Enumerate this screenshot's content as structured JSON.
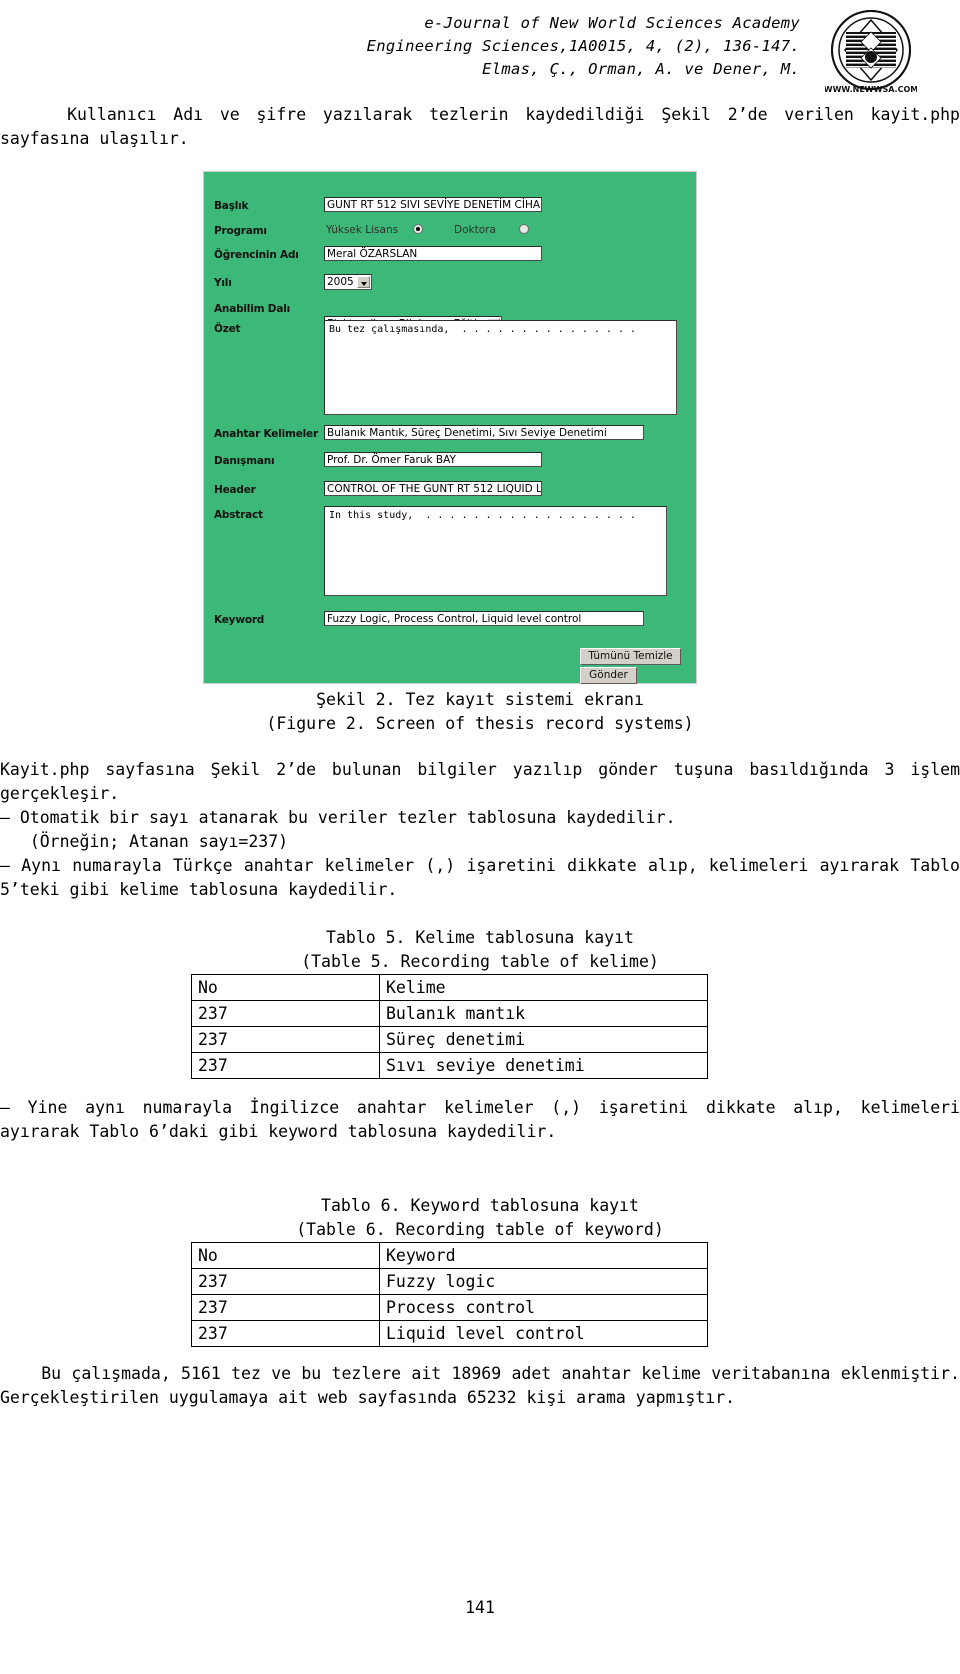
{
  "header": {
    "line1": "e-Journal of New World Sciences Academy",
    "line2": "Engineering Sciences,1A0015, 4, (2), 136-147.",
    "line3": "Elmas, Ç., Orman, A. ve Dener, M.",
    "logo_text_top": "WORLD SCIENCES",
    "logo_text_bottom": "NEW",
    "logo_text_right": "ACADEMY",
    "logo_url": "WWW.NEWWSA.COM",
    "logo_year": "1963"
  },
  "intro_paragraph": "    Kullanıcı Adı ve şifre yazılarak tezlerin kaydedildiği Şekil 2’de verilen kayit.php sayfasına ulaşılır.",
  "figure": {
    "fields": {
      "baslik_label": "Başlık",
      "baslik_value": "GUNT RT 512 SIVI SEVİYE DENETİM CİHA",
      "programi_label": "Programı",
      "programi_option1": "Yüksek Lisans",
      "programi_option2": "Doktora",
      "ogrenci_label": "Öğrencinin Adı",
      "ogrenci_value": "Meral ÖZARSLAN",
      "yili_label": "Yılı",
      "yili_value": "2005",
      "anabilim_label": "Anabilim Dalı",
      "anabilim_value": "Elektronik ve Bilgisayar Eğitimi",
      "ozet_label": "Özet",
      "ozet_value": "Bu tez çalışmasında,  . . . . . . . . . . . . . . .",
      "anahtar_label": "Anahtar Kelimeler",
      "anahtar_value": "Bulanık Mantık, Süreç Denetimi, Sıvı Seviye Denetimi",
      "danisman_label": "Danışmanı",
      "danisman_value": "Prof. Dr. Ömer Faruk BAY",
      "header_label": "Header",
      "header_value": "CONTROL OF THE GUNT RT 512 LIQUID L",
      "abstract_label": "Abstract",
      "abstract_value": "In this study,  . . . . . . . . . . . . . . . . . .",
      "keyword_label": "Keyword",
      "keyword_value": "Fuzzy Logic, Process Control, Liquid level control"
    },
    "buttons": {
      "clear_all": "Tümünü Temizle",
      "submit": "Gönder"
    },
    "background_color": "#3cb878"
  },
  "figure_caption": {
    "tr": "Şekil 2. Tez kayıt sistemi ekranı",
    "en": "(Figure 2. Screen of thesis record systems)"
  },
  "body": {
    "p1": "Kayit.php sayfasına Şekil 2’de bulunan bilgiler yazılıp gönder tuşuna basıldığında 3 işlem gerçekleşir.",
    "p2": "― Otomatik bir sayı atanarak bu veriler tezler tablosuna kaydedilir.",
    "p2b": "   (Örneğin; Atanan sayı=237)",
    "p3": "― Aynı numarayla Türkçe anahtar kelimeler (,) işaretini dikkate alıp, kelimeleri ayırarak Tablo 5’teki gibi kelime tablosuna kaydedilir.",
    "p4": "― Yine aynı numarayla İngilizce anahtar kelimeler (,) işaretini dikkate alıp, kelimeleri ayırarak Tablo 6’daki gibi keyword tablosuna kaydedilir.",
    "p5": "    Bu çalışmada, 5161 tez ve bu tezlere ait 18969 adet anahtar kelime veritabanına eklenmiştir. Gerçekleştirilen uygulamaya ait web sayfasında 65232 kişi arama yapmıştır."
  },
  "table5": {
    "caption_tr": "Tablo 5. Kelime tablosuna kayıt",
    "caption_en": "(Table 5. Recording table of kelime)",
    "headers": [
      "No",
      "Kelime"
    ],
    "rows": [
      [
        "237",
        "Bulanık mantık"
      ],
      [
        "237",
        "Süreç denetimi"
      ],
      [
        "237",
        "Sıvı seviye denetimi"
      ]
    ]
  },
  "table6": {
    "caption_tr": "Tablo 6. Keyword tablosuna kayıt",
    "caption_en": "(Table 6. Recording table of keyword)",
    "headers": [
      "No",
      "Keyword"
    ],
    "rows": [
      [
        "237",
        "Fuzzy logic"
      ],
      [
        "237",
        "Process control"
      ],
      [
        "237",
        "Liquid level control"
      ]
    ]
  },
  "page_number": "141"
}
